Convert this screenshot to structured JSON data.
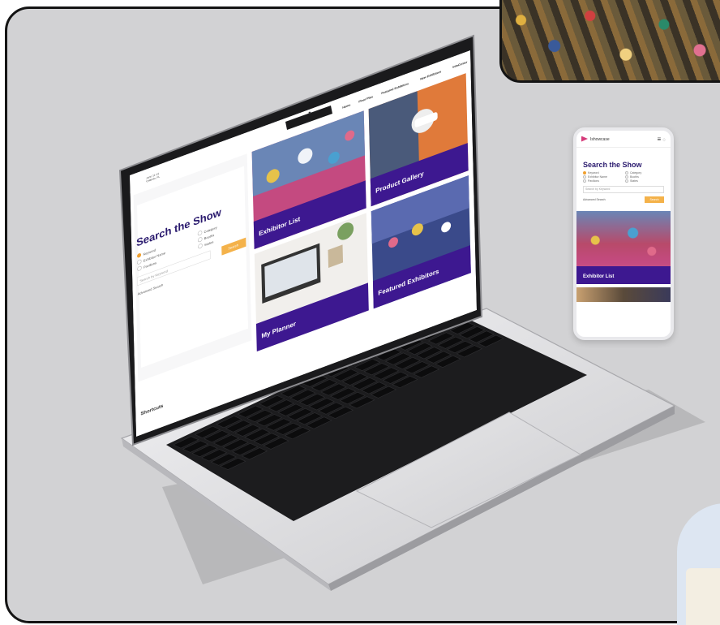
{
  "laptop_site": {
    "event_dates": "June 11-13",
    "event_location": "Orlando, FL",
    "nav": [
      "Home",
      "Floor Plan",
      "Featured Exhibitors",
      "New Exhibitors",
      "InfoCenter"
    ],
    "search": {
      "title": "Search the Show",
      "options_left": [
        "Keyword",
        "Exhibitor Name",
        "Pavilions"
      ],
      "options_right": [
        "Category",
        "Booths",
        "States"
      ],
      "placeholder": "Search by Keyword",
      "advanced": "Advanced Search",
      "button": "Search"
    },
    "tiles": [
      "Exhibitor List",
      "Product Gallery",
      "My Planner",
      "Featured Exhibitors"
    ],
    "shortcuts": "Shortcuts"
  },
  "mobile_site": {
    "brand": "Ishowcase",
    "search": {
      "title": "Search the Show",
      "options_left": [
        "Keyword",
        "Exhibitor Name",
        "Pavilions"
      ],
      "options_right": [
        "Category",
        "Booths",
        "States"
      ],
      "placeholder": "Search by Keyword",
      "advanced": "Advanced Search",
      "button": "Search"
    },
    "tile_label": "Exhibitor List"
  },
  "colors": {
    "background": "#d2d2d4",
    "brand_purple": "#3d1890",
    "accent_orange": "#f4b24a",
    "frame_border": "#141414"
  },
  "icons": [
    "hamburger-menu-icon",
    "bell-icon",
    "search-icon"
  ]
}
